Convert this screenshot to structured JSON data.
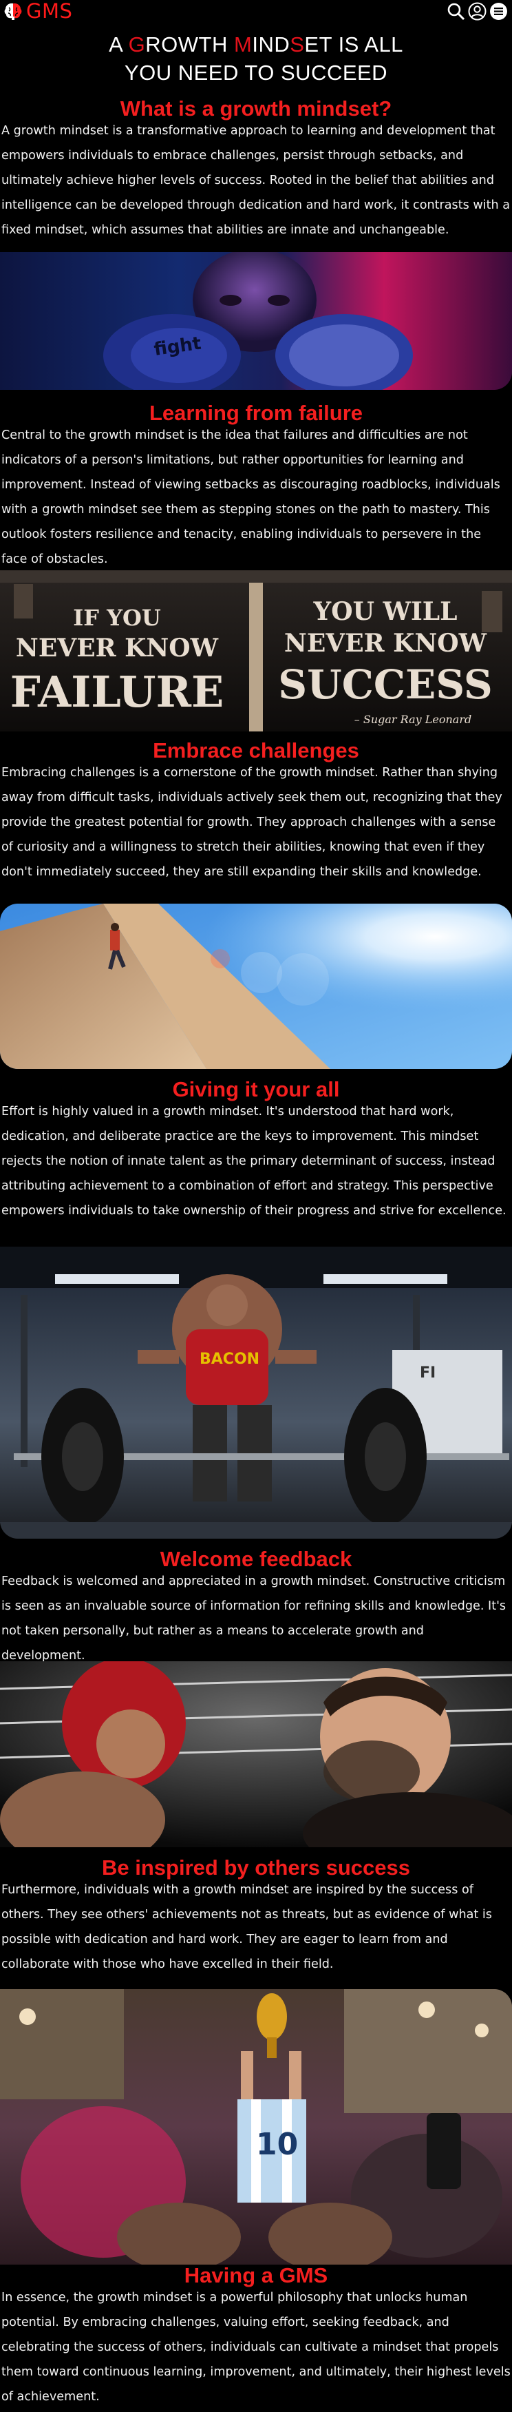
{
  "brand": {
    "name": "GMS",
    "accent": "#f41f1f"
  },
  "nav": {
    "icons": [
      "search-icon",
      "user-icon",
      "menu-icon"
    ]
  },
  "hero": {
    "p1": "A ",
    "r1": "G",
    "p2": "ROWTH ",
    "r2": "M",
    "p3": "IND",
    "r3": "S",
    "p4": "ET IS ALL",
    "line2": "YOU NEED TO SUCCEED"
  },
  "sections": [
    {
      "heading": "What is a growth mindset?",
      "text": "A growth mindset is a transformative approach to learning and development that empowers individuals to embrace challenges, persist through setbacks, and ultimately achieve higher levels of success. Rooted in the belief that abilities and intelligence can be developed through dedication and hard work, it contrasts with a fixed mindset, which assumes that abilities are innate and unchangeable."
    },
    {
      "heading": "Learning from failure",
      "text": "Central to the growth mindset is the idea that failures and difficulties are not indicators of a person's limitations, but rather opportunities for learning and improvement. Instead of viewing setbacks as discouraging roadblocks, individuals with a growth mindset see them as stepping stones on the path to mastery. This outlook fosters resilience and tenacity, enabling individuals to persevere in the face of obstacles."
    },
    {
      "heading": "Embrace challenges",
      "text": "Embracing challenges is a cornerstone of the growth mindset. Rather than shying away from difficult tasks, individuals actively seek them out, recognizing that they provide the greatest potential for growth. They approach challenges with a sense of curiosity and a willingness to stretch their abilities, knowing that even if they don't immediately succeed, they are still expanding their skills and knowledge."
    },
    {
      "heading": "Giving it your all",
      "text": "Effort is highly valued in a growth mindset. It's understood that hard work, dedication, and deliberate practice are the keys to improvement. This mindset rejects the notion of innate talent as the primary determinant of success, instead attributing achievement to a combination of effort and strategy. This perspective empowers individuals to take ownership of their progress and strive for excellence."
    },
    {
      "heading": "Welcome feedback",
      "text": "Feedback is welcomed and appreciated in a growth mindset. Constructive criticism is seen as an invaluable source of information for refining skills and knowledge. It's not taken personally, but rather as a means to accelerate growth and development."
    },
    {
      "heading": "Be inspired by others success",
      "text": "Furthermore, individuals with a growth mindset are inspired by the success of others. They see others' achievements not as threats, but as evidence of what is possible with dedication and hard work. They are eager to learn from and collaborate with those who have excelled in their field."
    },
    {
      "heading": "Having a GMS",
      "text": "In essence, the growth mindset is a powerful philosophy that unlocks human potential. By embracing challenges, valuing effort, seeking feedback, and celebrating the success of others, individuals can cultivate a mindset that propels them toward continuous learning, improvement, and ultimately, their highest levels of achievement."
    }
  ],
  "poster": {
    "left_top": "IF YOU",
    "left_mid": "NEVER KNOW",
    "left_big": "FAILURE",
    "right_top": "YOU WILL",
    "right_mid": "NEVER KNOW",
    "right_big": "SUCCESS",
    "signature": "– Sugar Ray Leonard"
  },
  "images": {
    "boxer": "boxer-portrait-image",
    "poster": "quote-poster-image",
    "climber": "rock-climber-image",
    "deadlift": "deadlift-gym-image",
    "boxing_match": "boxing-faceoff-image",
    "celebration": "trophy-celebration-image"
  }
}
